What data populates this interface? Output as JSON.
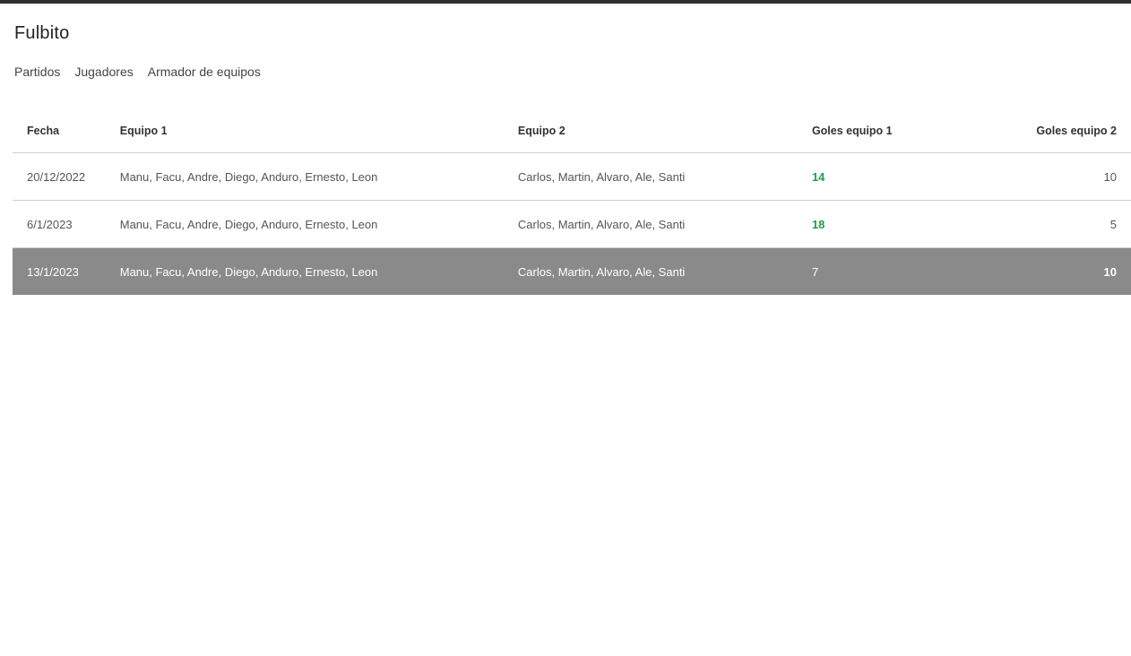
{
  "app": {
    "title": "Fulbito"
  },
  "nav": {
    "items": [
      {
        "label": "Partidos"
      },
      {
        "label": "Jugadores"
      },
      {
        "label": "Armador de equipos"
      }
    ]
  },
  "table": {
    "headers": {
      "fecha": "Fecha",
      "equipo1": "Equipo 1",
      "equipo2": "Equipo 2",
      "goles1": "Goles equipo 1",
      "goles2": "Goles equipo 2"
    },
    "rows": [
      {
        "fecha": "20/12/2022",
        "equipo1": "Manu, Facu, Andre, Diego, Anduro, Ernesto, Leon",
        "equipo2": "Carlos, Martin, Alvaro, Ale, Santi",
        "goles1": "14",
        "goles2": "10",
        "winner": "1"
      },
      {
        "fecha": "6/1/2023",
        "equipo1": "Manu, Facu, Andre, Diego, Anduro, Ernesto, Leon",
        "equipo2": "Carlos, Martin, Alvaro, Ale, Santi",
        "goles1": "18",
        "goles2": "5",
        "winner": "1"
      },
      {
        "fecha": "13/1/2023",
        "equipo1": "Manu, Facu, Andre, Diego, Anduro, Ernesto, Leon",
        "equipo2": "Carlos, Martin, Alvaro, Ale, Santi",
        "goles1": "7",
        "goles2": "10",
        "winner": "2"
      }
    ]
  },
  "colors": {
    "topbar": "#2f3034",
    "win": "#1e9e4a",
    "highlight_row": "#8a8a8a"
  }
}
